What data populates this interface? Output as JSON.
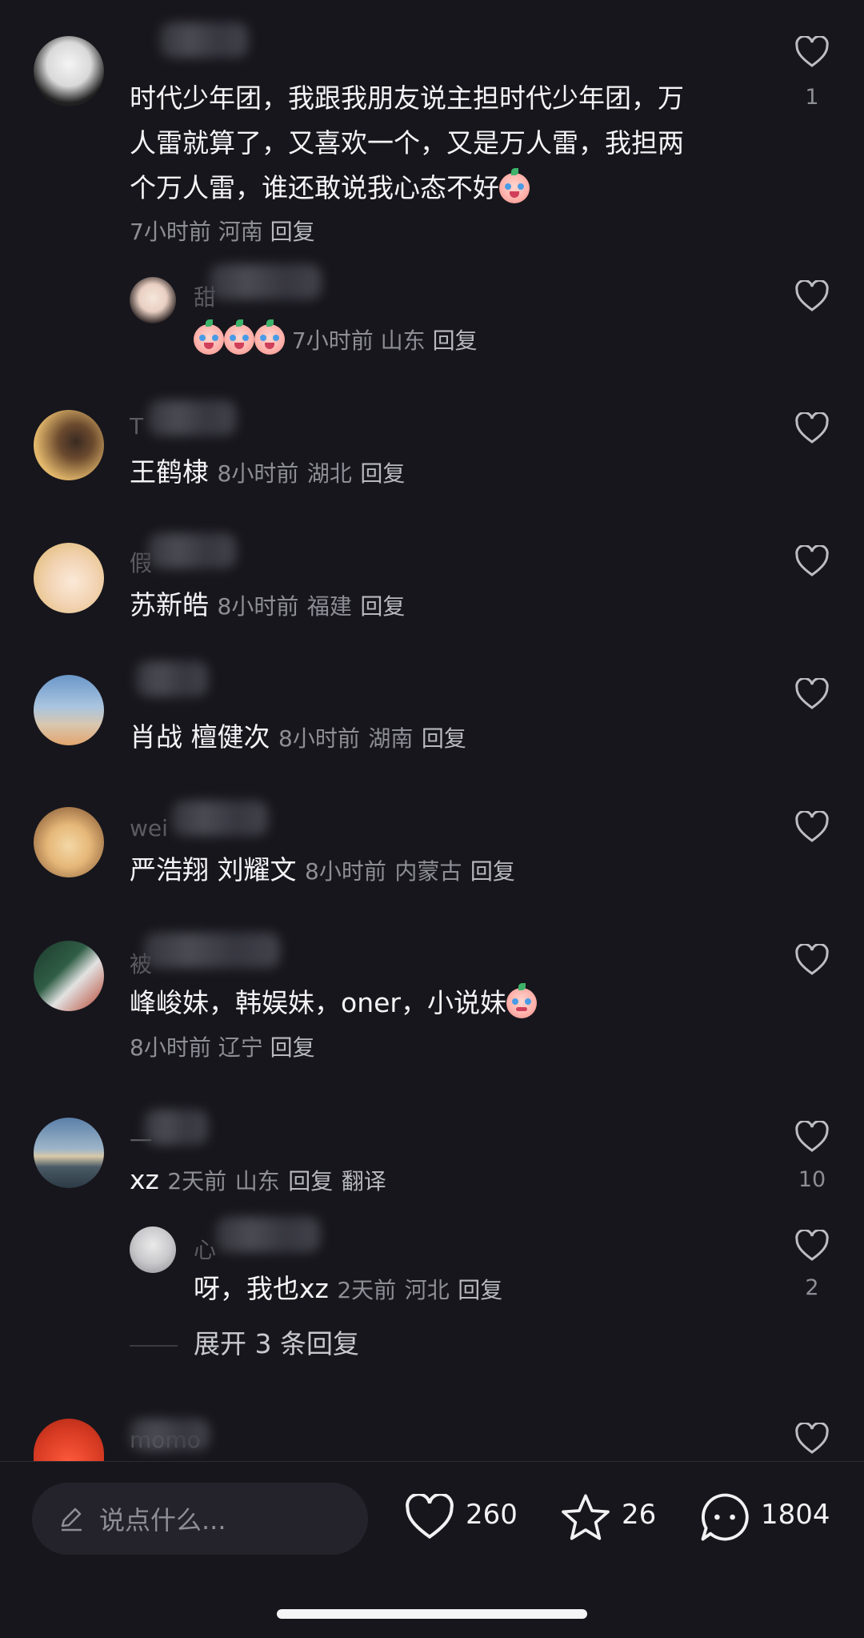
{
  "comments": [
    {
      "name_hint": "",
      "text_lines": [
        "时代少年团，我跟我朋友说主担时代少年团，万",
        "人雷就算了，又喜欢一个，又是万人雷，我担两",
        "个万人雷，谁还敢说我心态不好"
      ],
      "time": "7小时前",
      "location": "河南",
      "reply": "回复",
      "likes": "1"
    },
    {
      "name_hint": "甜",
      "text": "",
      "time": "7小时前",
      "location": "山东",
      "reply": "回复",
      "likes": ""
    },
    {
      "name_hint": "T",
      "text": "王鹤棣",
      "time": "8小时前",
      "location": "湖北",
      "reply": "回复",
      "likes": ""
    },
    {
      "name_hint": "假",
      "text": "苏新皓",
      "time": "8小时前",
      "location": "福建",
      "reply": "回复",
      "likes": ""
    },
    {
      "name_hint": "",
      "text": "肖战  檀健次",
      "time": "8小时前",
      "location": "湖南",
      "reply": "回复",
      "likes": ""
    },
    {
      "name_hint": "wei",
      "text": "严浩翔 刘耀文",
      "time": "8小时前",
      "location": "内蒙古",
      "reply": "回复",
      "likes": ""
    },
    {
      "name_hint": "被",
      "text": "峰峻妹，韩娱妹，oner，小说妹",
      "time": "8小时前",
      "location": "辽宁",
      "reply": "回复",
      "likes": ""
    },
    {
      "name_hint": "一",
      "text": "xz",
      "time": "2天前",
      "location": "山东",
      "reply": "回复",
      "translate": "翻译",
      "likes": "10"
    },
    {
      "name_hint": "心",
      "text": "呀，我也xz",
      "time": "2天前",
      "location": "河北",
      "reply": "回复",
      "likes": "2"
    },
    {
      "name_hint": "momo",
      "text": "",
      "likes": ""
    }
  ],
  "expand_replies": "展开 3 条回复",
  "bottom": {
    "input_placeholder": "说点什么...",
    "like_count": "260",
    "star_count": "26",
    "comment_count": "1804"
  },
  "icons": [
    "heart-icon",
    "pencil-icon",
    "star-icon",
    "comment-bubble-icon"
  ]
}
